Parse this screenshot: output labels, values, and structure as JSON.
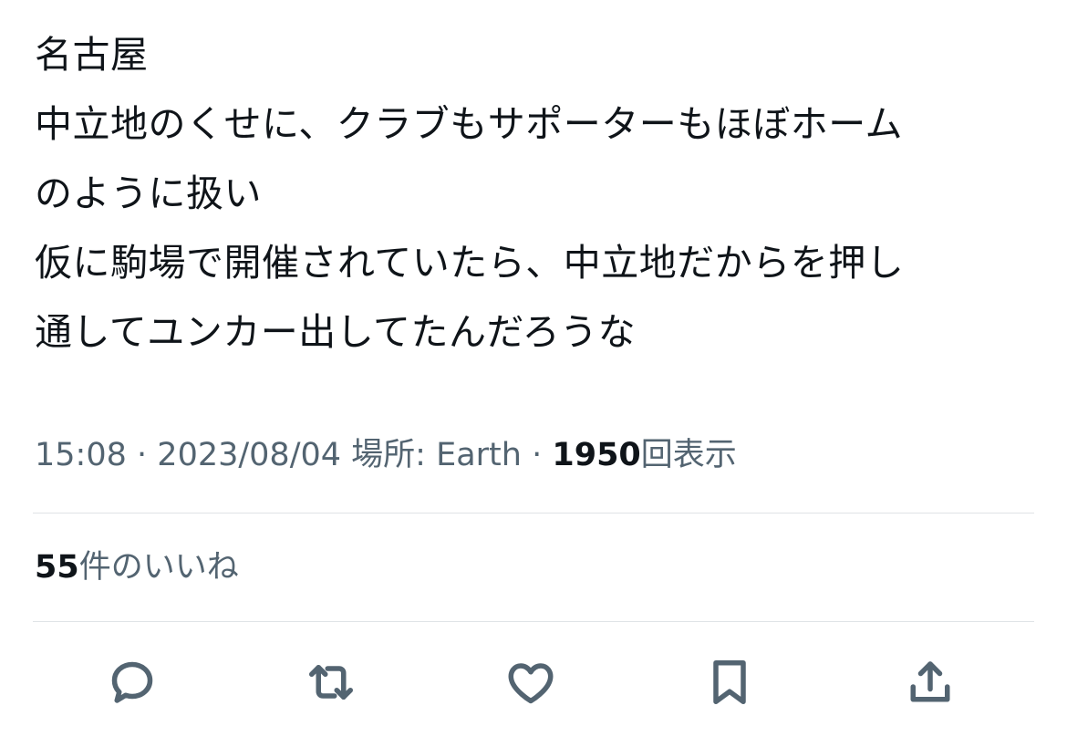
{
  "tweet": {
    "lines": [
      "名古屋",
      "中立地のくせに、クラブもサポーターもほぼホーム",
      "のように扱い",
      "仮に駒場で開催されていたら、中立地だからを押し",
      "通してユンカー出してたんだろうな"
    ],
    "time": "15:08",
    "separator": "·",
    "date": "2023/08/04",
    "location_label": "場所: Earth",
    "views_count": "1950",
    "views_label": "回表示"
  },
  "likes": {
    "count": "55",
    "label": "件のいいね"
  },
  "actions": {
    "icons": [
      "reply-icon",
      "retweet-icon",
      "like-icon",
      "bookmark-icon",
      "share-icon"
    ],
    "icon_color": "#536471"
  },
  "colors": {
    "text": "#0f1419",
    "secondary": "#536471",
    "divider": "#dfe3e6"
  }
}
